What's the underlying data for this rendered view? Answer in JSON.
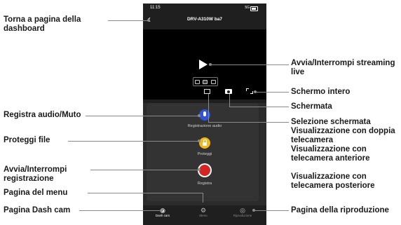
{
  "callouts": {
    "back_to_dashboard": "Torna a pagina della dashboard",
    "live_streaming": "Avvia/Interrompi streaming live",
    "fullscreen": "Schermo intero",
    "screenshot": "Schermata",
    "record_audio_mute": "Registra audio/Muto",
    "screen_selection": "Selezione schermata",
    "dual_camera_view": "Visualizzazione con doppia telecamera",
    "front_camera_view": "Visualizzazione con telecamera anteriore",
    "rear_camera_view": "Visualizzazione con telecamera posteriore",
    "protect_file": "Proteggi file",
    "start_stop_recording": "Avvia/Interrompi registrazione",
    "menu_page": "Pagina del menu",
    "dashcam_page": "Pagina Dash cam",
    "playback_page": "Pagina della riproduzione"
  },
  "phone": {
    "status_time": "11:15",
    "status_network": "5G",
    "device_name": "DRV-A310W ba7",
    "controls": {
      "record_audio_label": "Registrazione audio",
      "protect_label": "Proteggi",
      "record_label": "Registra"
    },
    "tabs": {
      "dashcam": "Dash cam",
      "menu": "Menu",
      "playback": "Riproduzione"
    }
  }
}
